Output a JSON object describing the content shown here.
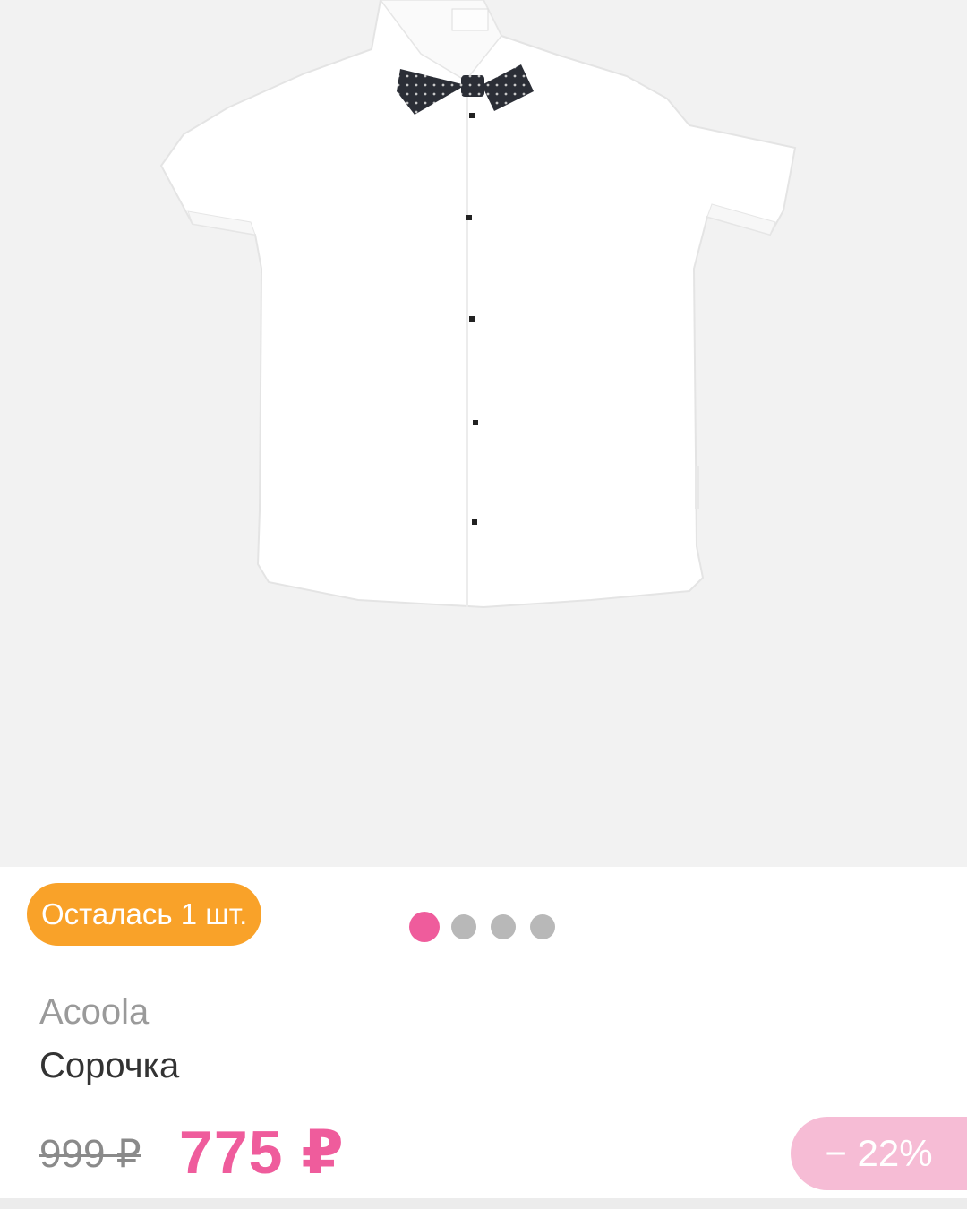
{
  "product": {
    "stock_badge": "Осталась 1 шт.",
    "brand": "Acoola",
    "name": "Сорочка",
    "old_price": "999 ₽",
    "new_price": "775 ₽",
    "discount": "− 22%",
    "image_alt": "shirt-with-bow-tie-photo"
  },
  "carousel": {
    "total": 4,
    "active_index": 0
  },
  "colors": {
    "accent": "#ef5c9c",
    "stock_badge": "#f9a229",
    "discount_badge": "#f6bcd5",
    "photo_background": "#f2f2f2"
  }
}
